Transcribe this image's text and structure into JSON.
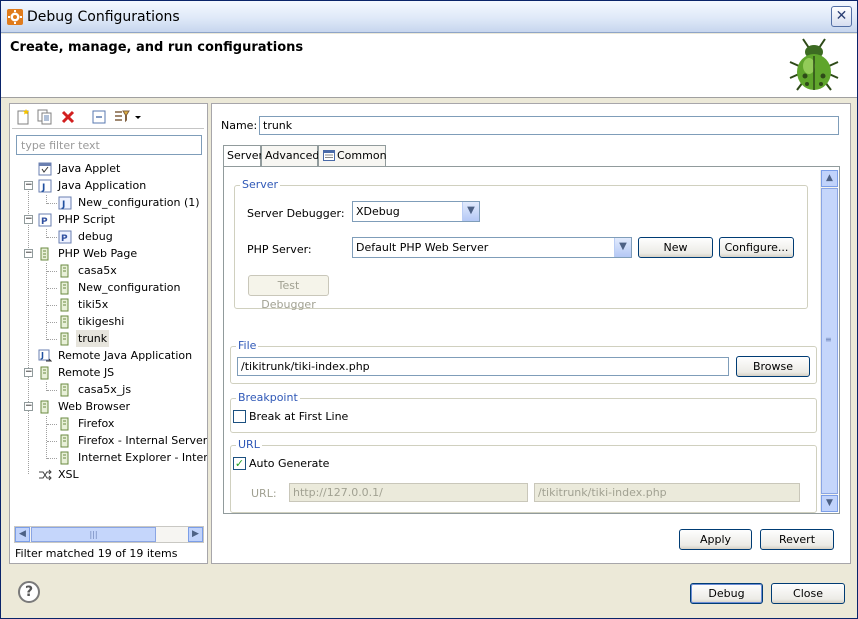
{
  "window": {
    "title": "Debug Configurations",
    "close_glyph": "✕"
  },
  "header": {
    "title": "Create, manage, and run configurations"
  },
  "left": {
    "filter_placeholder": "type filter text",
    "tree": [
      {
        "label": "Java Applet",
        "icon": "java-applet-icon"
      },
      {
        "label": "Java Application",
        "icon": "java-application-icon",
        "expanded": true
      },
      {
        "label": "New_configuration (1)",
        "icon": "java-config-icon"
      },
      {
        "label": "PHP Script",
        "icon": "php-script-icon",
        "expanded": true
      },
      {
        "label": "debug",
        "icon": "php-script-config-icon"
      },
      {
        "label": "PHP Web Page",
        "icon": "php-web-page-icon",
        "expanded": true
      },
      {
        "label": "casa5x",
        "icon": "php-web-page-config-icon"
      },
      {
        "label": "New_configuration",
        "icon": "php-web-page-config-icon"
      },
      {
        "label": "tiki5x",
        "icon": "php-web-page-config-icon"
      },
      {
        "label": "tikigeshi",
        "icon": "php-web-page-config-icon"
      },
      {
        "label": "trunk",
        "icon": "php-web-page-config-icon",
        "selected": true
      },
      {
        "label": "Remote Java Application",
        "icon": "remote-java-icon"
      },
      {
        "label": "Remote JS",
        "icon": "remote-js-icon",
        "expanded": true
      },
      {
        "label": "casa5x_js",
        "icon": "remote-js-config-icon"
      },
      {
        "label": "Web Browser",
        "icon": "web-browser-icon",
        "expanded": true
      },
      {
        "label": "Firefox",
        "icon": "web-browser-config-icon"
      },
      {
        "label": "Firefox - Internal Server",
        "icon": "web-browser-config-icon"
      },
      {
        "label": "Internet Explorer - Internal Server",
        "icon": "web-browser-config-icon"
      },
      {
        "label": "XSL",
        "icon": "xsl-icon"
      }
    ],
    "filter_status": "Filter matched 19 of 19 items"
  },
  "right": {
    "name_label": "Name:",
    "name_value": "trunk",
    "tabs": [
      {
        "label": "Server",
        "active": true
      },
      {
        "label": "Advanced"
      },
      {
        "label": "Common",
        "icon": "common-tab-icon"
      }
    ],
    "server_group": {
      "title": "Server",
      "debugger_label": "Server Debugger:",
      "debugger_value": "XDebug",
      "php_server_label": "PHP Server:",
      "php_server_value": "Default PHP Web Server",
      "new_label": "New",
      "configure_label": "Configure...",
      "test_label": "Test Debugger"
    },
    "file_group": {
      "title": "File",
      "value": "/tikitrunk/tiki-index.php",
      "browse_label": "Browse"
    },
    "breakpoint_group": {
      "title": "Breakpoint",
      "checkbox_label": "Break at First Line",
      "checked": false
    },
    "url_group": {
      "title": "URL",
      "auto_label": "Auto Generate",
      "auto_checked": true,
      "url_label": "URL:",
      "url_base": "http://127.0.0.1/",
      "url_path": "/tikitrunk/tiki-index.php"
    },
    "apply_label": "Apply",
    "revert_label": "Revert"
  },
  "footer": {
    "help_glyph": "?",
    "debug_label": "Debug",
    "close_label": "Close"
  }
}
